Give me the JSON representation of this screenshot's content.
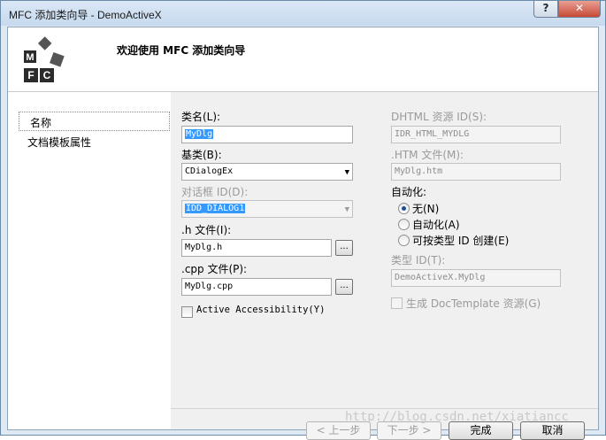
{
  "window": {
    "title": "MFC 添加类向导 - DemoActiveX",
    "help_label": "?",
    "close_label": "✕"
  },
  "header": {
    "welcome": "欢迎使用 MFC 添加类向导",
    "logo_letters": [
      "M",
      "F",
      "C"
    ]
  },
  "nav": {
    "items": [
      {
        "label": "名称",
        "selected": true
      },
      {
        "label": "文档模板属性",
        "selected": false
      }
    ]
  },
  "form": {
    "class_name_label": "类名(L):",
    "class_name_value": "MyDlg",
    "base_class_label": "基类(B):",
    "base_class_value": "CDialogEx",
    "dialog_id_label": "对话框 ID(D):",
    "dialog_id_value": "IDD_DIALOG1",
    "h_file_label": ".h 文件(I):",
    "h_file_value": "MyDlg.h",
    "cpp_file_label": ".cpp 文件(P):",
    "cpp_file_value": "MyDlg.cpp",
    "browse_label": "...",
    "accessibility_label": "Active Accessibility(Y)",
    "dhtml_label": "DHTML 资源 ID(S):",
    "dhtml_value": "IDR_HTML_MYDLG",
    "htm_label": ".HTM 文件(M):",
    "htm_value": "MyDlg.htm",
    "automation_label": "自动化:",
    "radio_none": "无(N)",
    "radio_automation": "自动化(A)",
    "radio_createable": "可按类型 ID 创建(E)",
    "type_id_label": "类型 ID(T):",
    "type_id_value": "DemoActiveX.MyDlg",
    "doctemplate_label": "生成 DocTemplate 资源(G)"
  },
  "buttons": {
    "back": "< 上一步",
    "next": "下一步 >",
    "finish": "完成",
    "cancel": "取消"
  },
  "watermark": "http://blog.csdn.net/xiatiancc",
  "colors": {
    "selection": "#3399ff",
    "close_button": "#c74a36"
  }
}
